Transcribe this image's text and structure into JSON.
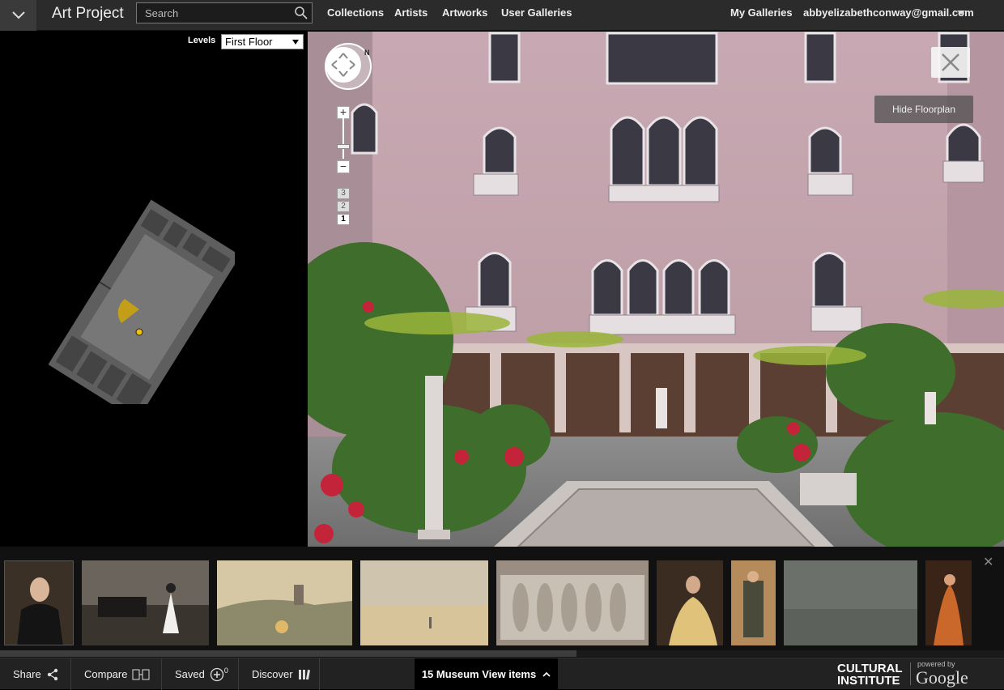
{
  "topbar": {
    "brand": "Art Project",
    "search_placeholder": "Search",
    "nav": [
      "Collections",
      "Artists",
      "Artworks",
      "User Galleries"
    ],
    "my_galleries": "My Galleries",
    "account_email": "abbyelizabethconway@gmail.com"
  },
  "floorplan_panel": {
    "levels_label": "Levels",
    "selected_level": "First Floor"
  },
  "viewer": {
    "floor_buttons": [
      "3",
      "2",
      "1"
    ],
    "compass_label": "N",
    "hide_floorplan": "Hide Floorplan",
    "zoom_in": "+",
    "zoom_out": "−"
  },
  "thumbnails": [
    {
      "name": "portrait-woman-black-dress"
    },
    {
      "name": "spanish-dancer-scene"
    },
    {
      "name": "river-landscape-ruins"
    },
    {
      "name": "beach-seascape"
    },
    {
      "name": "carved-sarcophagus-relief"
    },
    {
      "name": "woman-in-yellow-dress"
    },
    {
      "name": "figure-in-costume"
    },
    {
      "name": "gray-seascape"
    },
    {
      "name": "figure-in-orange"
    }
  ],
  "bottombar": {
    "share": "Share",
    "compare": "Compare",
    "saved": "Saved",
    "saved_count": "0",
    "discover": "Discover",
    "museum_view": "15 Museum View items",
    "ci_line1": "CULTURAL",
    "ci_line2": "INSTITUTE",
    "powered_by": "powered by",
    "google": "Google"
  },
  "colors": {
    "topbar": "#2b2b2b",
    "bottombar": "#222222",
    "floorplan_fill": "#6d6d6d",
    "marker": "#f2c200"
  }
}
